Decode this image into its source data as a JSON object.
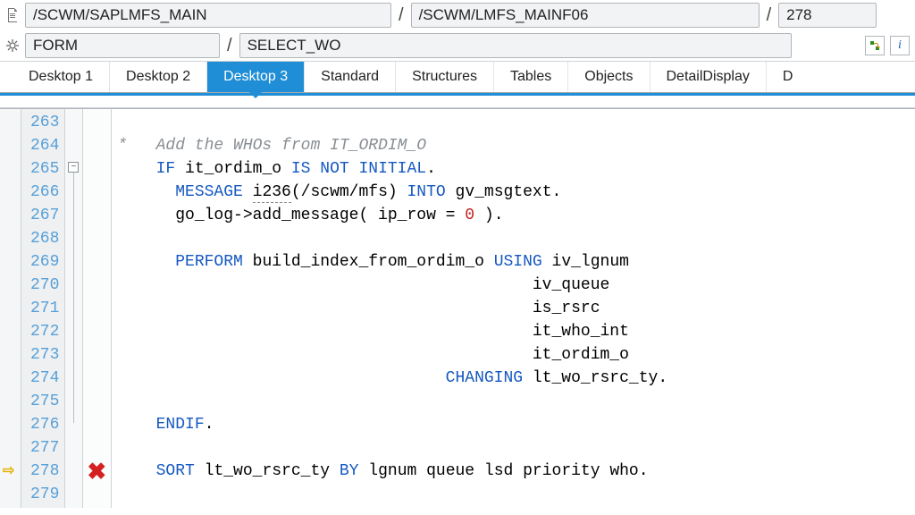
{
  "path": {
    "program": "/SCWM/SAPLMFS_MAIN",
    "include": "/SCWM/LMFS_MAINF06",
    "line": "278",
    "form_kw": "FORM",
    "form_name": "SELECT_WO"
  },
  "tabs": [
    {
      "label": "Desktop 1",
      "active": false
    },
    {
      "label": "Desktop 2",
      "active": false
    },
    {
      "label": "Desktop 3",
      "active": true
    },
    {
      "label": "Standard",
      "active": false
    },
    {
      "label": "Structures",
      "active": false
    },
    {
      "label": "Tables",
      "active": false
    },
    {
      "label": "Objects",
      "active": false
    },
    {
      "label": "DetailDisplay",
      "active": false
    },
    {
      "label": "D",
      "active": false
    }
  ],
  "code": {
    "first_line": 263,
    "breakpoint_line": 278,
    "lines": [
      {
        "n": 263,
        "frag": [
          [
            "",
            "    "
          ]
        ]
      },
      {
        "n": 264,
        "frag": [
          [
            "cmt",
            "*   Add the WHOs from IT_ORDIM_O"
          ]
        ]
      },
      {
        "n": 265,
        "frag": [
          [
            "",
            "    "
          ],
          [
            "kw",
            "IF"
          ],
          [
            "",
            " it_ordim_o "
          ],
          [
            "kw",
            "IS NOT INITIAL"
          ],
          [
            "",
            "."
          ]
        ]
      },
      {
        "n": 266,
        "frag": [
          [
            "",
            "      "
          ],
          [
            "kw",
            "MESSAGE"
          ],
          [
            "",
            " i236(/scwm/mfs) "
          ],
          [
            "kw",
            "INTO"
          ],
          [
            "",
            " gv_msgtext."
          ]
        ]
      },
      {
        "n": 267,
        "frag": [
          [
            "",
            "      go_log->add_message( ip_row = "
          ],
          [
            "num",
            "0"
          ],
          [
            "",
            " )."
          ]
        ]
      },
      {
        "n": 268,
        "frag": [
          [
            "",
            ""
          ]
        ]
      },
      {
        "n": 269,
        "frag": [
          [
            "",
            "      "
          ],
          [
            "kw",
            "PERFORM"
          ],
          [
            "",
            " build_index_from_ordim_o "
          ],
          [
            "kw",
            "USING"
          ],
          [
            "",
            " iv_lgnum"
          ]
        ]
      },
      {
        "n": 270,
        "frag": [
          [
            "",
            "                                           iv_queue"
          ]
        ]
      },
      {
        "n": 271,
        "frag": [
          [
            "",
            "                                           is_rsrc"
          ]
        ]
      },
      {
        "n": 272,
        "frag": [
          [
            "",
            "                                           it_who_int"
          ]
        ]
      },
      {
        "n": 273,
        "frag": [
          [
            "",
            "                                           it_ordim_o"
          ]
        ]
      },
      {
        "n": 274,
        "frag": [
          [
            "",
            "                                  "
          ],
          [
            "kw",
            "CHANGING"
          ],
          [
            "",
            " lt_wo_rsrc_ty."
          ]
        ]
      },
      {
        "n": 275,
        "frag": [
          [
            "",
            ""
          ]
        ]
      },
      {
        "n": 276,
        "frag": [
          [
            "",
            "    "
          ],
          [
            "kw",
            "ENDIF"
          ],
          [
            "",
            "."
          ]
        ]
      },
      {
        "n": 277,
        "frag": [
          [
            "",
            ""
          ]
        ]
      },
      {
        "n": 278,
        "frag": [
          [
            "",
            "    "
          ],
          [
            "kw",
            "SORT"
          ],
          [
            "",
            " lt_wo_rsrc_ty "
          ],
          [
            "kw",
            "BY"
          ],
          [
            "",
            " lgnum queue lsd priority who."
          ]
        ],
        "err": true
      },
      {
        "n": 279,
        "frag": [
          [
            "",
            ""
          ]
        ]
      }
    ]
  }
}
